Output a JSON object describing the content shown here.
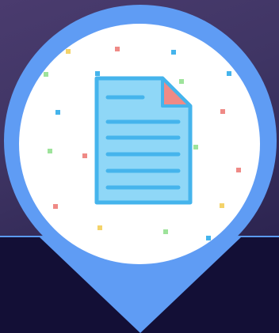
{
  "scene": {
    "icon": "document-file-icon",
    "secondary_icon": "map-pin-marker-icon",
    "colors": {
      "bg_top": "#4a3b6e",
      "bg_bottom": "#130f36",
      "pin_blue": "#5f9cf4",
      "circle_white": "#ffffff",
      "doc_fill": "#8fd7f7",
      "doc_border": "#45b4ec",
      "doc_corner": "#ef8a86"
    }
  }
}
